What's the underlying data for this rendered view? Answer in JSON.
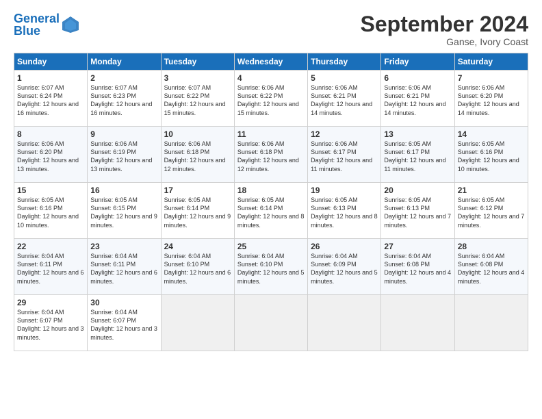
{
  "header": {
    "logo_text_general": "General",
    "logo_text_blue": "Blue",
    "month_title": "September 2024",
    "location": "Ganse, Ivory Coast"
  },
  "days_of_week": [
    "Sunday",
    "Monday",
    "Tuesday",
    "Wednesday",
    "Thursday",
    "Friday",
    "Saturday"
  ],
  "weeks": [
    [
      {
        "day": "1",
        "sunrise": "6:07 AM",
        "sunset": "6:24 PM",
        "daylight": "12 hours and 16 minutes."
      },
      {
        "day": "2",
        "sunrise": "6:07 AM",
        "sunset": "6:23 PM",
        "daylight": "12 hours and 16 minutes."
      },
      {
        "day": "3",
        "sunrise": "6:07 AM",
        "sunset": "6:22 PM",
        "daylight": "12 hours and 15 minutes."
      },
      {
        "day": "4",
        "sunrise": "6:06 AM",
        "sunset": "6:22 PM",
        "daylight": "12 hours and 15 minutes."
      },
      {
        "day": "5",
        "sunrise": "6:06 AM",
        "sunset": "6:21 PM",
        "daylight": "12 hours and 14 minutes."
      },
      {
        "day": "6",
        "sunrise": "6:06 AM",
        "sunset": "6:21 PM",
        "daylight": "12 hours and 14 minutes."
      },
      {
        "day": "7",
        "sunrise": "6:06 AM",
        "sunset": "6:20 PM",
        "daylight": "12 hours and 14 minutes."
      }
    ],
    [
      {
        "day": "8",
        "sunrise": "6:06 AM",
        "sunset": "6:20 PM",
        "daylight": "12 hours and 13 minutes."
      },
      {
        "day": "9",
        "sunrise": "6:06 AM",
        "sunset": "6:19 PM",
        "daylight": "12 hours and 13 minutes."
      },
      {
        "day": "10",
        "sunrise": "6:06 AM",
        "sunset": "6:18 PM",
        "daylight": "12 hours and 12 minutes."
      },
      {
        "day": "11",
        "sunrise": "6:06 AM",
        "sunset": "6:18 PM",
        "daylight": "12 hours and 12 minutes."
      },
      {
        "day": "12",
        "sunrise": "6:06 AM",
        "sunset": "6:17 PM",
        "daylight": "12 hours and 11 minutes."
      },
      {
        "day": "13",
        "sunrise": "6:05 AM",
        "sunset": "6:17 PM",
        "daylight": "12 hours and 11 minutes."
      },
      {
        "day": "14",
        "sunrise": "6:05 AM",
        "sunset": "6:16 PM",
        "daylight": "12 hours and 10 minutes."
      }
    ],
    [
      {
        "day": "15",
        "sunrise": "6:05 AM",
        "sunset": "6:16 PM",
        "daylight": "12 hours and 10 minutes."
      },
      {
        "day": "16",
        "sunrise": "6:05 AM",
        "sunset": "6:15 PM",
        "daylight": "12 hours and 9 minutes."
      },
      {
        "day": "17",
        "sunrise": "6:05 AM",
        "sunset": "6:14 PM",
        "daylight": "12 hours and 9 minutes."
      },
      {
        "day": "18",
        "sunrise": "6:05 AM",
        "sunset": "6:14 PM",
        "daylight": "12 hours and 8 minutes."
      },
      {
        "day": "19",
        "sunrise": "6:05 AM",
        "sunset": "6:13 PM",
        "daylight": "12 hours and 8 minutes."
      },
      {
        "day": "20",
        "sunrise": "6:05 AM",
        "sunset": "6:13 PM",
        "daylight": "12 hours and 7 minutes."
      },
      {
        "day": "21",
        "sunrise": "6:05 AM",
        "sunset": "6:12 PM",
        "daylight": "12 hours and 7 minutes."
      }
    ],
    [
      {
        "day": "22",
        "sunrise": "6:04 AM",
        "sunset": "6:11 PM",
        "daylight": "12 hours and 6 minutes."
      },
      {
        "day": "23",
        "sunrise": "6:04 AM",
        "sunset": "6:11 PM",
        "daylight": "12 hours and 6 minutes."
      },
      {
        "day": "24",
        "sunrise": "6:04 AM",
        "sunset": "6:10 PM",
        "daylight": "12 hours and 6 minutes."
      },
      {
        "day": "25",
        "sunrise": "6:04 AM",
        "sunset": "6:10 PM",
        "daylight": "12 hours and 5 minutes."
      },
      {
        "day": "26",
        "sunrise": "6:04 AM",
        "sunset": "6:09 PM",
        "daylight": "12 hours and 5 minutes."
      },
      {
        "day": "27",
        "sunrise": "6:04 AM",
        "sunset": "6:08 PM",
        "daylight": "12 hours and 4 minutes."
      },
      {
        "day": "28",
        "sunrise": "6:04 AM",
        "sunset": "6:08 PM",
        "daylight": "12 hours and 4 minutes."
      }
    ],
    [
      {
        "day": "29",
        "sunrise": "6:04 AM",
        "sunset": "6:07 PM",
        "daylight": "12 hours and 3 minutes."
      },
      {
        "day": "30",
        "sunrise": "6:04 AM",
        "sunset": "6:07 PM",
        "daylight": "12 hours and 3 minutes."
      },
      null,
      null,
      null,
      null,
      null
    ]
  ]
}
